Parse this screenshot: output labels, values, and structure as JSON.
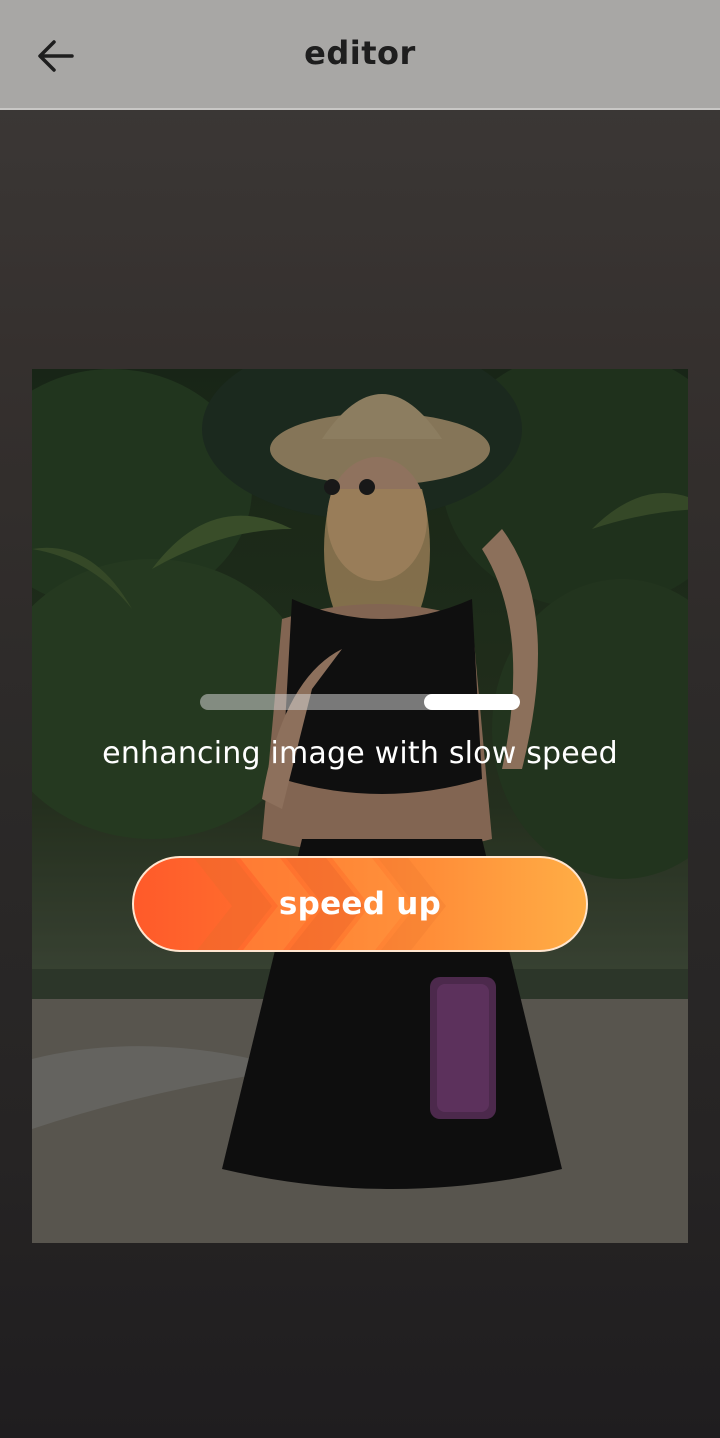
{
  "header": {
    "title": "editor",
    "back_icon": "arrow-left-icon"
  },
  "image": {
    "description_icon": "photo-preview"
  },
  "progress": {
    "value": 0.3,
    "start": 0.7
  },
  "status": {
    "text": "enhancing image with slow speed"
  },
  "action": {
    "label": "speed up",
    "icon": "chevrons-right-icon"
  },
  "colors": {
    "header_bg": "#a8a7a5",
    "button_start": "#ff5a2a",
    "button_end": "#ffad45",
    "progress_fill": "#ffffff"
  }
}
